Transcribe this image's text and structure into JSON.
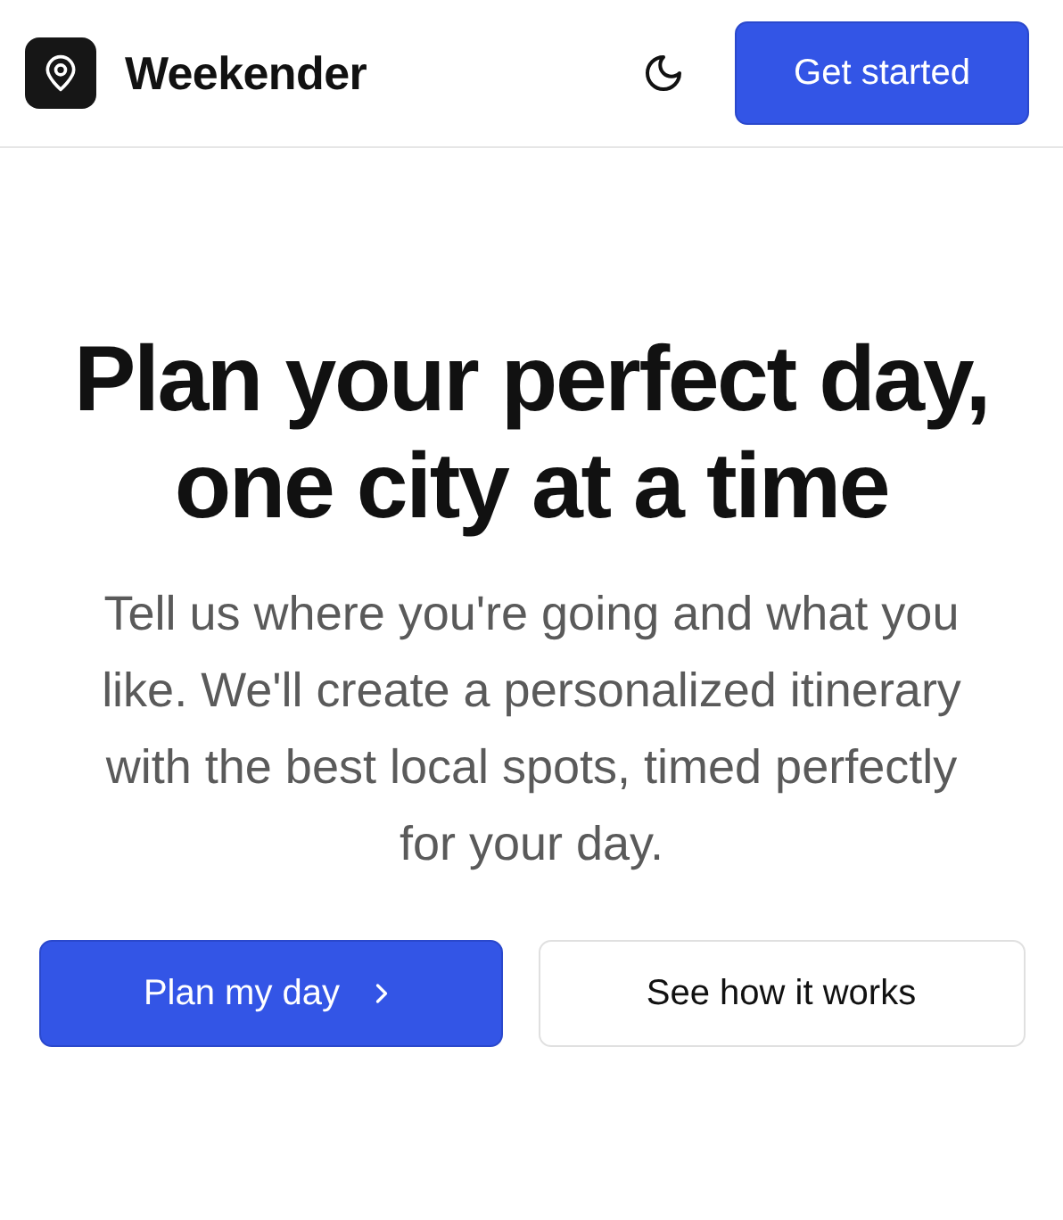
{
  "header": {
    "brand": "Weekender",
    "cta": "Get started"
  },
  "hero": {
    "title_lines": [
      "Plan your perfect day,",
      "one city at a time"
    ],
    "description": "Tell us where you're going and what you like. We'll create a personalized itinerary with the best local spots, timed perfectly for your day."
  },
  "actions": [
    {
      "label": "Plan my day",
      "kind": "primary"
    },
    {
      "label": "See how it works",
      "kind": "secondary"
    }
  ]
}
